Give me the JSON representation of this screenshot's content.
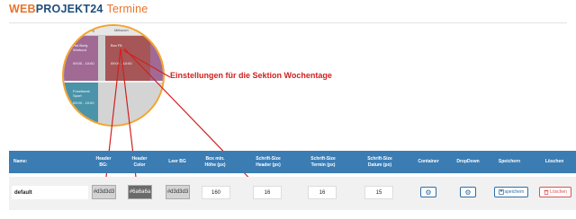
{
  "brand": {
    "part1": "WEB",
    "part2": "PROJEKT24",
    "subtitle": "Termine"
  },
  "callout": {
    "text": "Einstellungen für die Sektion Wochentage"
  },
  "lens": {
    "day_left": "Dienstag",
    "day_mid": "Mittwoch",
    "block1_title": "Hot Body Workout",
    "block1_time": "09:00 - 10:00",
    "block2_title": "Box Fit",
    "block2_time": "09:00 - 10:00",
    "block3_title": "Functional Sport",
    "block3_time": "09:00 - 10:00"
  },
  "columns": {
    "name": "Name:",
    "header_bg": [
      "Header",
      "BG:"
    ],
    "header_color": [
      "Header",
      "Color"
    ],
    "leer_bg": [
      "Leer BG"
    ],
    "box_min_hoehe": [
      "Box min.",
      "Höhe (px)"
    ],
    "schrift_header": [
      "Schrift-Size",
      "Header (px)"
    ],
    "schrift_termin": [
      "Schrift-Size",
      "Termin (px)"
    ],
    "schrift_datum": [
      "Schrift-Size",
      "Datum (px)"
    ],
    "container": [
      "Container"
    ],
    "dropdown": [
      "DropDown"
    ],
    "speichern": [
      "Speichern"
    ],
    "loeschen": [
      "Löschen"
    ]
  },
  "row": {
    "name": "default",
    "header_bg": "#d3d3d3",
    "header_color": "#6a6a6a",
    "leer_bg": "#d3d3d3",
    "box_min_hoehe": "160",
    "schrift_header": "16",
    "schrift_termin": "16",
    "schrift_datum": "15",
    "save_label": "speichern",
    "delete_label": "Löschen"
  },
  "colors": {
    "accent_orange": "#e8732a",
    "brand_blue": "#1f4e7a",
    "table_header": "#3b7cb3",
    "annotation_red": "#d22020",
    "lens_purple": "#a06a95",
    "lens_red": "#a65656",
    "lens_teal": "#4a93a8"
  },
  "icons": {
    "container": "gears-icon",
    "dropdown": "gears-icon",
    "save": "save-icon",
    "delete": "trash-icon"
  }
}
